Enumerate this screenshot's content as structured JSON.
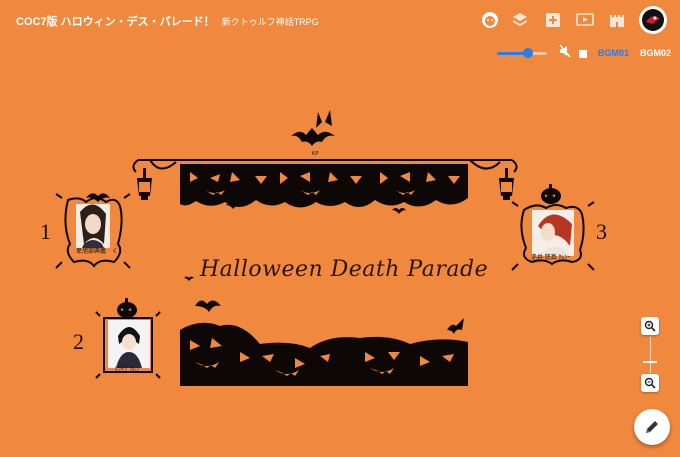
{
  "room": {
    "title": "COC7版 ハロウィン・デス・パレード！",
    "subtitle": "新クトゥルフ神話TRPG"
  },
  "toolbar": {
    "icons": [
      "face-icon",
      "layers-icon",
      "add-image-icon",
      "video-icon",
      "castle-icon"
    ],
    "avatar_icon": "ghost-avatar-icon"
  },
  "audio": {
    "volume": 0.62,
    "mute_icon": "volume-off-icon",
    "stop_icon": "stop-icon",
    "tracks": [
      {
        "label": "BGM01",
        "color": "#2b7de9"
      },
      {
        "label": "BGM02",
        "color": "#ffffff"
      }
    ]
  },
  "scene": {
    "banner_title": "Halloween Death Parade",
    "top_tag": "KP",
    "characters": [
      {
        "number": "1",
        "name": "卑旭部興義　く"
      },
      {
        "number": "2",
        "name": "ﾚﾝﾄﾌﾞｸﾚﾝ"
      },
      {
        "number": "3",
        "name": "赤井 悠真 ｸﾚﾝｰ"
      }
    ]
  },
  "zoom": {
    "in_icon": "zoom-in-icon",
    "out_icon": "zoom-out-icon",
    "level": 0.5
  },
  "fab": {
    "icon": "pencil-icon"
  },
  "colors": {
    "background": "#f0883e",
    "accent": "#2b7de9",
    "silhouette": "#0d0806"
  }
}
